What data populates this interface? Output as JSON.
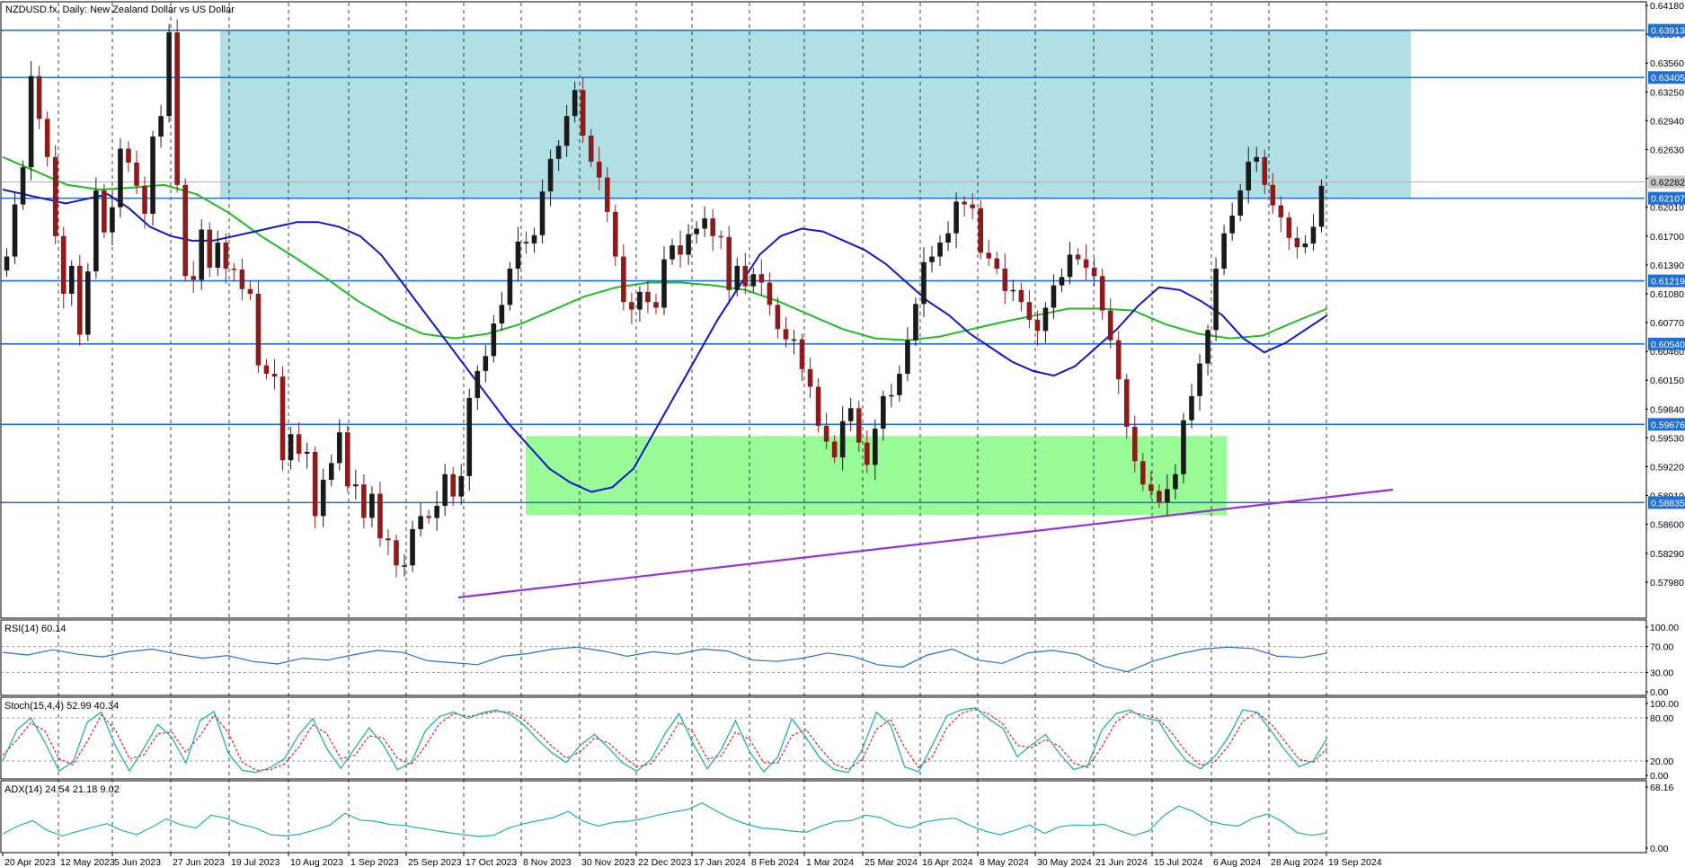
{
  "chart_data": {
    "type": "candlestick",
    "title": "NZDUSD.fx, Daily:  New Zealand Dollar vs US Dollar",
    "symbol": "NZDUSD.fx",
    "timeframe": "Daily",
    "price_axis": {
      "range": [
        0.5767,
        0.6418
      ],
      "ticks": [
        "0.64180",
        "0.63870",
        "0.63560",
        "0.63250",
        "0.62940",
        "0.62630",
        "0.62320",
        "0.62010",
        "0.61700",
        "0.61390",
        "0.61080",
        "0.60770",
        "0.60460",
        "0.60150",
        "0.59840",
        "0.59530",
        "0.59220",
        "0.58910",
        "0.58600",
        "0.58290",
        "0.57980"
      ]
    },
    "date_labels": [
      "20 Apr 2023",
      "12 May 2023",
      "5 Jun 2023",
      "27 Jun 2023",
      "19 Jul 2023",
      "10 Aug 2023",
      "1 Sep 2023",
      "25 Sep 2023",
      "17 Oct 2023",
      "8 Nov 2023",
      "30 Nov 2023",
      "22 Dec 2023",
      "17 Jan 2024",
      "8 Feb 2024",
      "1 Mar 2024",
      "25 Mar 2024",
      "16 Apr 2024",
      "8 May 2024",
      "30 May 2024",
      "21 Jun 2024",
      "15 Jul 2024",
      "6 Aug 2024",
      "28 Aug 2024",
      "19 Sep 2024"
    ],
    "horizontal_levels": [
      "0.63913",
      "0.63405",
      "0.62107",
      "0.61219",
      "0.60540",
      "0.59676",
      "0.58835"
    ],
    "current_price": "0.62282",
    "colors": {
      "bull": "#1a1a1a",
      "bear": "#8b1c1c",
      "level_line": "#1f6fd6",
      "resistance_zone": "#b0e0e6",
      "support_zone": "#98fb98",
      "ma_fast": "#1414cc",
      "ma_slow": "#22bb22",
      "trendline": "#9b30d9",
      "rsi_line": "#1f6fd6",
      "stoch_main": "#20b2aa",
      "stoch_signal": "#e02020",
      "adx_main": "#20b2aa"
    },
    "series": [
      {
        "name": "Close",
        "values": [
          0.6148,
          0.6204,
          0.6244,
          0.6342,
          0.6296,
          0.6255,
          0.617,
          0.6108,
          0.6138,
          0.6064,
          0.6132,
          0.6219,
          0.6174,
          0.6201,
          0.6264,
          0.6249,
          0.6224,
          0.6194,
          0.6277,
          0.6299,
          0.6389,
          0.6225,
          0.6127,
          0.6123,
          0.6177,
          0.6136,
          0.6163,
          0.6135,
          0.6134,
          0.6113,
          0.6108,
          0.6031,
          0.6022,
          0.6019,
          0.5929,
          0.5957,
          0.5936,
          0.5938,
          0.5869,
          0.5908,
          0.5926,
          0.5959,
          0.5901,
          0.5903,
          0.5867,
          0.5893,
          0.5845,
          0.5843,
          0.5816,
          0.5816,
          0.5855,
          0.5869,
          0.5867,
          0.588,
          0.5914,
          0.589,
          0.5912,
          0.5996,
          0.6025,
          0.6041,
          0.6076,
          0.6096,
          0.6135,
          0.6164,
          0.6162,
          0.6171,
          0.6218,
          0.6253,
          0.6267,
          0.6299,
          0.6327,
          0.6278,
          0.625,
          0.6233,
          0.6196,
          0.6148,
          0.6099,
          0.6091,
          0.611,
          0.6099,
          0.6093,
          0.6145,
          0.616,
          0.615,
          0.6172,
          0.6178,
          0.6189,
          0.617,
          0.6169,
          0.6112,
          0.6138,
          0.6116,
          0.6129,
          0.612,
          0.6096,
          0.607,
          0.6059,
          0.6059,
          0.6027,
          0.6008,
          0.5966,
          0.5949,
          0.5932,
          0.5971,
          0.5985,
          0.5948,
          0.5924,
          0.5963,
          0.5998,
          0.5999,
          0.6022,
          0.6058,
          0.6097,
          0.6142,
          0.6148,
          0.6163,
          0.6173,
          0.6207,
          0.6204,
          0.62,
          0.6152,
          0.6146,
          0.6135,
          0.6111,
          0.6112,
          0.6099,
          0.608,
          0.6068,
          0.6093,
          0.6117,
          0.6126,
          0.615,
          0.6145,
          0.6136,
          0.6127,
          0.609,
          0.6058,
          0.6016,
          0.5965,
          0.5928,
          0.5903,
          0.5896,
          0.5884,
          0.5898,
          0.5914,
          0.5972,
          0.5998,
          0.6033,
          0.6069,
          0.6135,
          0.6173,
          0.6192,
          0.6219,
          0.625,
          0.6255,
          0.6225,
          0.6203,
          0.619,
          0.6168,
          0.6158,
          0.6162,
          0.618,
          0.6224
        ]
      },
      {
        "name": "MA fast",
        "values": [
          0.622,
          0.6215,
          0.621,
          0.6205,
          0.621,
          0.6215,
          0.62,
          0.618,
          0.617,
          0.6165,
          0.6165,
          0.617,
          0.6175,
          0.618,
          0.6185,
          0.6185,
          0.618,
          0.617,
          0.615,
          0.612,
          0.609,
          0.606,
          0.603,
          0.6,
          0.597,
          0.5945,
          0.592,
          0.5905,
          0.5895,
          0.59,
          0.592,
          0.596,
          0.6,
          0.604,
          0.608,
          0.6115,
          0.615,
          0.617,
          0.6178,
          0.6175,
          0.6165,
          0.6155,
          0.614,
          0.612,
          0.61,
          0.6085,
          0.6065,
          0.605,
          0.6035,
          0.6025,
          0.602,
          0.603,
          0.605,
          0.607,
          0.6095,
          0.6115,
          0.6112,
          0.61,
          0.6085,
          0.606,
          0.6045,
          0.6055,
          0.607,
          0.6085
        ]
      },
      {
        "name": "MA slow",
        "values": [
          0.6255,
          0.624,
          0.6225,
          0.622,
          0.6222,
          0.6225,
          0.6215,
          0.6195,
          0.617,
          0.6148,
          0.6125,
          0.61,
          0.608,
          0.6065,
          0.606,
          0.6065,
          0.6075,
          0.609,
          0.6105,
          0.6115,
          0.612,
          0.612,
          0.6117,
          0.6112,
          0.61,
          0.6085,
          0.607,
          0.606,
          0.6058,
          0.6062,
          0.607,
          0.6078,
          0.6085,
          0.6092,
          0.6092,
          0.609,
          0.6075,
          0.6065,
          0.606,
          0.6063,
          0.6078,
          0.6092
        ]
      },
      {
        "name": "RSI(14)",
        "values": [
          61,
          57,
          65,
          58,
          54,
          62,
          66,
          58,
          52,
          56,
          47,
          43,
          52,
          49,
          57,
          64,
          61,
          48,
          45,
          42,
          55,
          59,
          66,
          69,
          63,
          55,
          62,
          58,
          66,
          63,
          49,
          47,
          52,
          60,
          55,
          42,
          38,
          57,
          66,
          49,
          44,
          60,
          64,
          58,
          40,
          31,
          47,
          58,
          66,
          69,
          67,
          55,
          53,
          60
        ]
      },
      {
        "name": "Stoch main",
        "values": [
          20,
          63,
          80,
          46,
          6,
          19,
          74,
          88,
          41,
          6,
          37,
          71,
          53,
          17,
          76,
          89,
          31,
          7,
          4,
          11,
          23,
          56,
          79,
          37,
          10,
          38,
          66,
          43,
          8,
          18,
          62,
          82,
          88,
          79,
          87,
          91,
          85,
          70,
          49,
          31,
          18,
          42,
          57,
          38,
          17,
          6,
          22,
          58,
          86,
          44,
          9,
          36,
          76,
          33,
          5,
          25,
          79,
          53,
          24,
          8,
          4,
          36,
          88,
          70,
          12,
          5,
          43,
          83,
          91,
          94,
          78,
          65,
          26,
          42,
          57,
          30,
          8,
          14,
          63,
          86,
          91,
          80,
          76,
          45,
          20,
          9,
          26,
          54,
          91,
          88,
          62,
          35,
          12,
          20,
          52
        ]
      },
      {
        "name": "Stoch signal",
        "values": [
          28,
          49,
          73,
          62,
          23,
          15,
          47,
          84,
          63,
          23,
          28,
          58,
          60,
          32,
          55,
          84,
          60,
          18,
          7,
          8,
          16,
          39,
          70,
          58,
          23,
          28,
          55,
          52,
          24,
          15,
          41,
          72,
          86,
          82,
          85,
          89,
          88,
          77,
          59,
          40,
          24,
          33,
          52,
          45,
          27,
          12,
          16,
          41,
          74,
          60,
          23,
          27,
          60,
          50,
          18,
          17,
          55,
          64,
          38,
          16,
          8,
          22,
          64,
          78,
          39,
          11,
          27,
          66,
          86,
          92,
          85,
          71,
          42,
          38,
          50,
          40,
          17,
          11,
          40,
          74,
          88,
          84,
          79,
          58,
          32,
          14,
          19,
          41,
          75,
          88,
          72,
          47,
          22,
          18,
          38
        ]
      },
      {
        "name": "ADX(14)",
        "values": [
          23,
          36,
          45,
          29,
          20,
          27,
          34,
          40,
          29,
          22,
          34,
          48,
          38,
          33,
          54,
          49,
          39,
          33,
          22,
          20,
          23,
          30,
          38,
          57,
          46,
          44,
          39,
          37,
          33,
          29,
          25,
          22,
          19,
          21,
          33,
          40,
          45,
          50,
          60,
          44,
          36,
          42,
          44,
          48,
          54,
          59,
          63,
          74,
          60,
          48,
          39,
          33,
          31,
          28,
          26,
          36,
          44,
          45,
          54,
          50,
          38,
          33,
          43,
          47,
          49,
          37,
          28,
          22,
          29,
          38,
          24,
          35,
          38,
          37,
          39,
          29,
          21,
          28,
          53,
          69,
          60,
          45,
          39,
          36,
          49,
          56,
          43,
          25,
          21,
          25
        ]
      }
    ],
    "rsi_axis": {
      "range": [
        0,
        100
      ],
      "ticks": [
        "100.00",
        "70.00",
        "30.00",
        "0.00"
      ]
    },
    "stoch_axis": {
      "range": [
        0,
        100
      ],
      "ticks": [
        "100.00",
        "80.00",
        "20.00",
        "0.00"
      ]
    },
    "adx_axis": {
      "ticks": [
        "68.16",
        "0.00"
      ]
    },
    "indicators": [
      {
        "label": "RSI(14) 60.14"
      },
      {
        "label": "Stoch(15,4,4) 52.99 40.34"
      },
      {
        "label": "ADX(14) 24.54 21.18 9.02"
      }
    ]
  }
}
